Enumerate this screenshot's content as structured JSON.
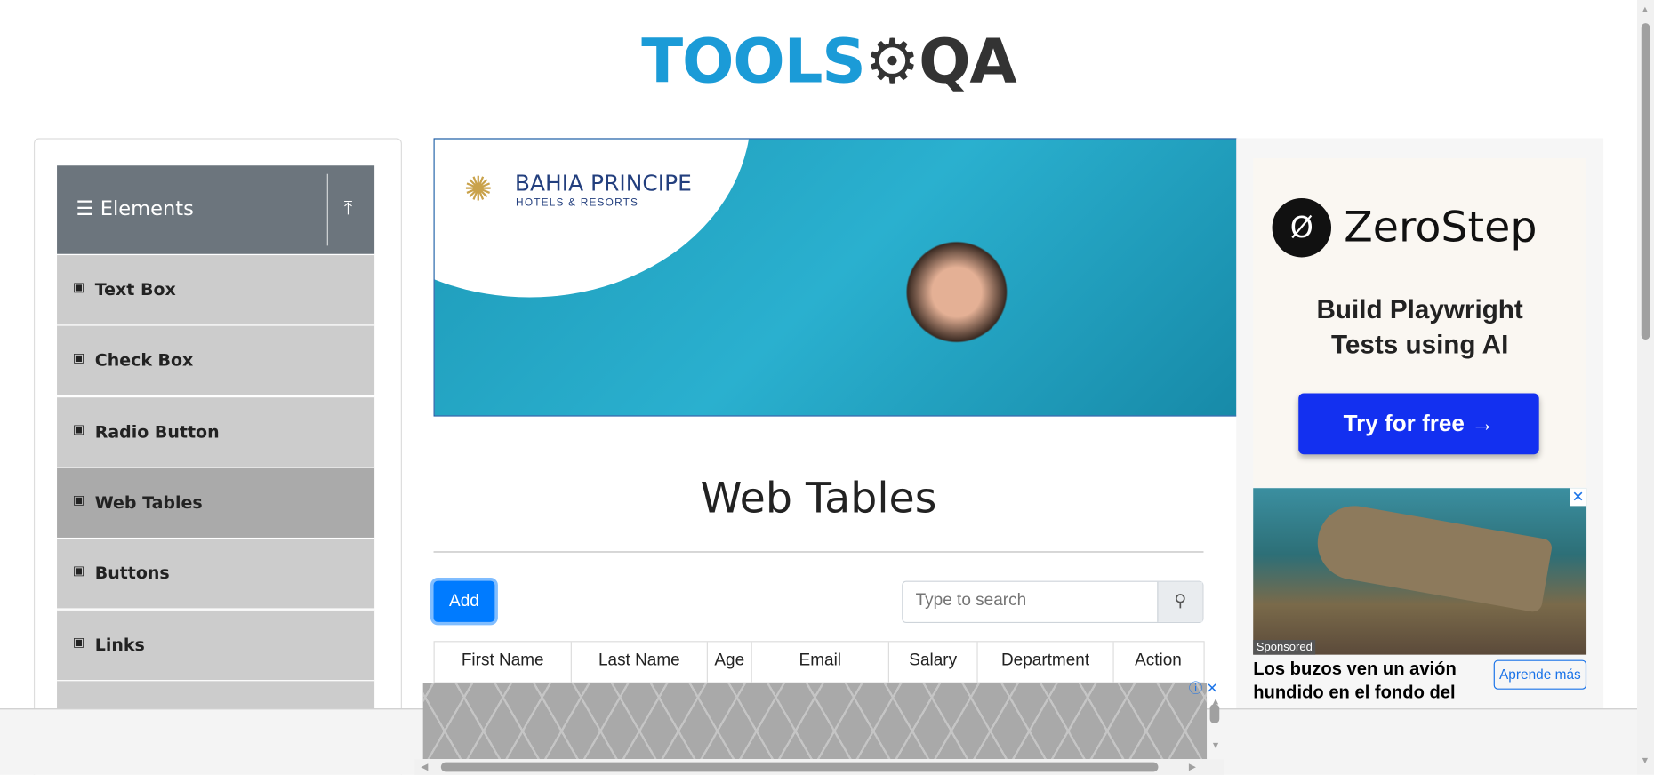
{
  "logo": {
    "part1": "TOOLS",
    "part2": "QA"
  },
  "sidebar": {
    "group_title": "Elements",
    "items": [
      {
        "label": "Text Box"
      },
      {
        "label": "Check Box"
      },
      {
        "label": "Radio Button"
      },
      {
        "label": "Web Tables",
        "active": true
      },
      {
        "label": "Buttons"
      },
      {
        "label": "Links"
      }
    ]
  },
  "banner_ad": {
    "brand": "BAHIA PRINCIPE",
    "sub": "HOTELS & RESORTS"
  },
  "right_ad": {
    "brand": "ZeroStep",
    "tagline_1": "Build Playwright",
    "tagline_2": "Tests using AI",
    "cta": "Try for free →"
  },
  "right_ad2": {
    "sponsored": "Sponsored",
    "headline": "Los buzos ven un avión hundido en el fondo del",
    "cta": "Aprende más"
  },
  "main": {
    "title": "Web Tables",
    "add_label": "Add",
    "search_placeholder": "Type to search",
    "columns": [
      "First Name",
      "Last Name",
      "Age",
      "Email",
      "Salary",
      "Department",
      "Action"
    ]
  },
  "colors": {
    "accent": "#007bff",
    "sidebar_header": "#6c757d",
    "sidebar_item": "#cccccc",
    "sidebar_active": "#aaaaaa"
  }
}
